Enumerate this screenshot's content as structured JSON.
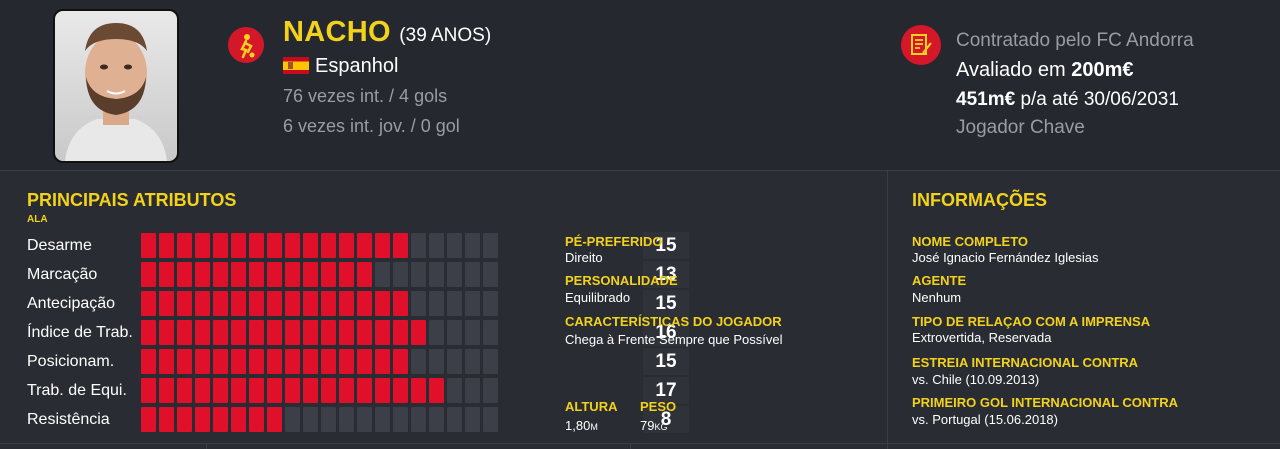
{
  "header": {
    "name": "NACHO",
    "age": "(39 ANOS)",
    "nationality": "Espanhol",
    "caps_senior": "76 vezes int. / 4 gols",
    "caps_youth": "6 vezes int. jov. / 0 gol",
    "contract_club": "Contratado pelo FC Andorra",
    "value_prefix": "Avaliado em ",
    "value_amount": "200m€",
    "wage_amount": "451m€",
    "wage_suffix": " p/a até 30/06/2031",
    "status": "Jogador Chave"
  },
  "attributes": {
    "title": "PRINCIPAIS ATRIBUTOS",
    "role": "ALA",
    "max": 20,
    "items": [
      {
        "name": "Desarme",
        "value": 15
      },
      {
        "name": "Marcação",
        "value": 13
      },
      {
        "name": "Antecipação",
        "value": 15
      },
      {
        "name": "Índice de Trab.",
        "value": 16
      },
      {
        "name": "Posicionam.",
        "value": 15
      },
      {
        "name": "Trab. de Equi.",
        "value": 17
      },
      {
        "name": "Resistência",
        "value": 8
      }
    ]
  },
  "details": {
    "foot_label": "PÉ-PREFERIDO",
    "foot_value": "Direito",
    "personality_label": "PERSONALIDADE",
    "personality_value": "Equilibrado",
    "traits_label": "CARACTERÍSTICAS DO JOGADOR",
    "traits_value": "Chega à Frente Sempre que Possível",
    "height_label": "ALTURA",
    "height_value": "1,80",
    "height_unit": "M",
    "weight_label": "PESO",
    "weight_value": "79",
    "weight_unit": "KG"
  },
  "info": {
    "title": "INFORMAÇÕES",
    "full_name_label": "NOME COMPLETO",
    "full_name_value": "José Ignacio Fernández Iglesias",
    "agent_label": "AGENTE",
    "agent_value": "Nenhum",
    "press_label": "TIPO DE RELAÇAO COM A IMPRENSA",
    "press_value": "Extrovertida, Reservada",
    "debut_label": "ESTREIA INTERNACIONAL CONTRA",
    "debut_value": "vs. Chile (10.09.2013)",
    "first_goal_label": "PRIMEIRO GOL INTERNACIONAL CONTRA",
    "first_goal_value": "vs. Portugal (15.06.2018)"
  },
  "colors": {
    "accent": "#f2d21b",
    "bar_on": "#e0102a",
    "bar_off": "#3c3f48",
    "icon_red": "#d4182a",
    "background": "#2a2c33"
  },
  "icons": {
    "position": "football-player-icon",
    "contract": "contract-icon",
    "flag": "spain-flag-icon"
  }
}
